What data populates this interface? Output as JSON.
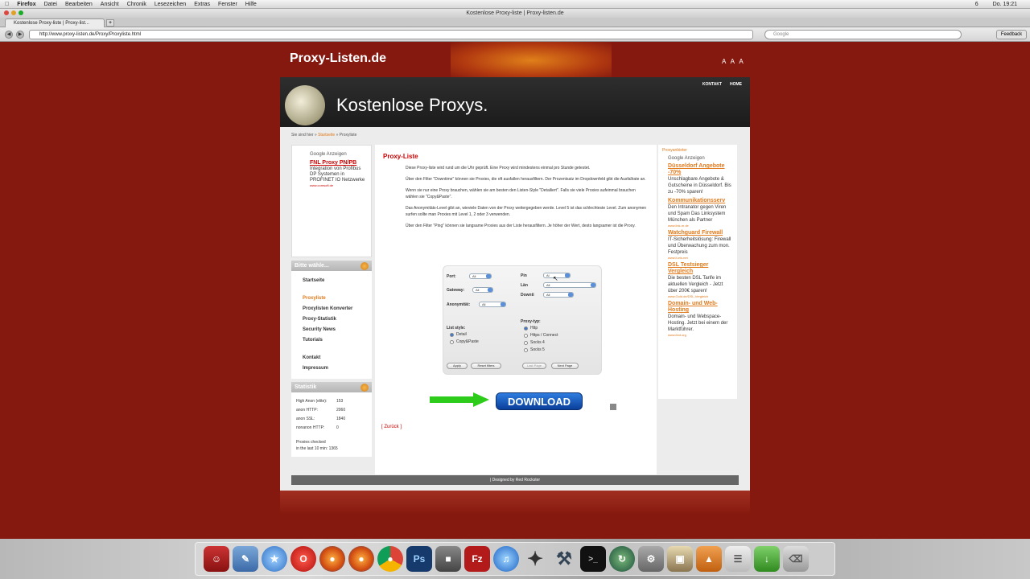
{
  "menubar": {
    "apple": "",
    "app": "Firefox",
    "items": [
      "Datei",
      "Bearbeiten",
      "Ansicht",
      "Chronik",
      "Lesezeichen",
      "Extras",
      "Fenster",
      "Hilfe"
    ],
    "right": [
      "6",
      "Do. 19:21"
    ]
  },
  "window": {
    "title": "Kostenlose Proxy-liste | Proxy-listen.de"
  },
  "tab": {
    "label": "Kostenlose Proxy-liste | Proxy-list...",
    "new": "+"
  },
  "nav": {
    "url": "http://www.proxy-listen.de/Proxy/Proxyliste.html",
    "search_placeholder": "Google",
    "feedback": "Feedback"
  },
  "site": {
    "title": "Proxy-Listen.de",
    "font_sizes": "A A A",
    "header_nav": [
      "KONTAKT",
      "HOME"
    ],
    "heading": "Kostenlose Proxys."
  },
  "breadcrumb": {
    "prefix": "Sie sind hier »",
    "link": "Startseite",
    "sep": "»",
    "current": "Proxyliste"
  },
  "left_ad": {
    "google": "Google Anzeigen",
    "link": "FNL Proxy PN/PB",
    "text": "Integration von Profibus DP Systemen in PROFINET IO Netzwerke",
    "url": "www.comsoft.de"
  },
  "menu": {
    "header": "Bitte wähle...",
    "items": [
      "Startseite",
      "Proxyliste",
      "Proxylisten Konverter",
      "Proxy-Statistik",
      "Security News",
      "Tutorials",
      "Kontakt",
      "Impressum"
    ]
  },
  "stats": {
    "header": "Statistik",
    "rows": [
      {
        "label": "High Anon (elite):",
        "value": "153"
      },
      {
        "label": "anon HTTP:",
        "value": "2060"
      },
      {
        "label": "anon SSL:",
        "value": "1840"
      },
      {
        "label": "nonanon HTTP:",
        "value": "0"
      }
    ],
    "checked_label": "Proxies checked",
    "checked_line": "in the last 10 min: 1365"
  },
  "main": {
    "title": "Proxy-Liste",
    "paragraphs": [
      "Diese Proxy-liste wird rund um die Uhr geprüft. Eine Proxy wird mindestens einmal pro Stunde getestet.",
      "Über den Filter \"Downtime\" können sie Proxies, die oft ausfallen herausfiltern. Der Prozentsatz im Dropdownfeld gibt die Ausfallrate an.",
      "Wenn sie nur eine Proxy brauchen, wählen sie am besten den Listen-Style \"Detailiert\". Falls sie viele Proxies aufeinmal brauchen wählen sie \"Copy&Paste\".",
      "Das Anonymitäts-Level gibt an, wieviele Daten von der Proxy weitergegeben werde. Level 5 ist das schlechteste Level. Zum anonymen surfen sollte man Proxies mit Level 1, 2 oder 3 verwenden.",
      "Über den Filter \"Ping\" können sie langsame Proxies aus der Liste herausfiltern. Je höher der Wert, desto langsamer ist die Proxy."
    ],
    "back": "[ Zurück ]",
    "download": "DOWNLOAD"
  },
  "filter": {
    "port_label": "Port:",
    "port_value": "All",
    "gateway_label": "Gateway:",
    "gateway_value": "All",
    "anon_label": "Anonymität:",
    "anon_value": "All",
    "ping_label": "Pin",
    "ping_value": "Al",
    "land_label": "Län",
    "land_value": "All",
    "down_label": "Downti",
    "down_value": "All",
    "list_style_label": "List style:",
    "list_styles": [
      "Detail",
      "Copy&Paste"
    ],
    "proxy_type_label": "Proxy-typ:",
    "proxy_types": [
      "Http",
      "Https / Connect",
      "Socks 4",
      "Socks 5"
    ],
    "apply": "Apply",
    "reset": "Reset filters",
    "last": "Last Page",
    "next": "Next Page"
  },
  "right_ads": {
    "partner": "Proxyanbieter",
    "google": "Google Anzeigen",
    "ads": [
      {
        "link": "Düsseldorf Angebote -70%",
        "text": "Unschlagbare Angebote & Gutscheine in Düsseldorf. Bis zu -70% sparen!",
        "url": ""
      },
      {
        "link": "Kommunikationsserv",
        "text": "Den Intranator gegen Viren und Spam Das Linksystem München als Partner",
        "url": "www.link-m.de"
      },
      {
        "link": "Watchguard Firewall",
        "text": "IT-Sicherheitslösung: Firewall und Überwachung zum mon. Festpreis",
        "url": "www.it-eis.net"
      },
      {
        "link": "DSL Testsieger Vergleich",
        "text": "Die besten DSL Tarife im aktuellen Vergleich - Jetzt über 200€ sparen!",
        "url": "www.Gold.de/DSL-Vergleich"
      },
      {
        "link": "Domain- und Web-Hosting",
        "text": "Domain- und Webspace-Hosting. Jetzt bei einem der Marktführer.",
        "url": "www.ibnt.org"
      }
    ]
  },
  "footer": {
    "text": "| Designed by Red Rockster"
  },
  "colors": {
    "accent": "#e07a1c",
    "link_red": "#cc0000",
    "bg": "#86190f"
  },
  "dock": {
    "icons": [
      "finder-icon",
      "preview-icon",
      "safari-icon",
      "opera-icon",
      "firefox-icon",
      "firefox-beta-icon",
      "chrome-icon",
      "photoshop-icon",
      "vmware-icon",
      "filezilla-icon",
      "itunes-icon",
      "star-icon",
      "xcode-icon",
      "terminal-icon",
      "time-machine-icon",
      "system-preferences-icon",
      "iphoto-icon",
      "applications-icon",
      "documents-icon",
      "downloads-icon",
      "trash-icon"
    ],
    "filezilla_label": "Fz",
    "ps_label": "Ps"
  }
}
